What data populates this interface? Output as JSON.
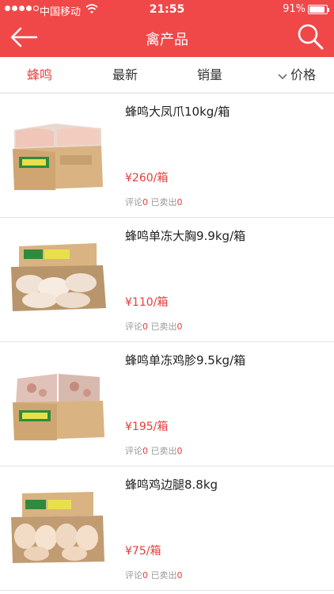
{
  "status_bar": {
    "carrier": "中国移动",
    "time": "21:55",
    "battery_text": "91%",
    "battery_level": 0.91
  },
  "header": {
    "title": "禽产品",
    "back_icon": "arrow-left-icon",
    "search_icon": "search-icon"
  },
  "tabs": [
    {
      "label": "蜂鸣",
      "active": true
    },
    {
      "label": "最新",
      "active": false
    },
    {
      "label": "销量",
      "active": false
    },
    {
      "label": "价格",
      "active": false
    }
  ],
  "meta_labels": {
    "comment": "评论",
    "sold": "已卖出"
  },
  "products": [
    {
      "title": "蜂鸣大凤爪10kg/箱",
      "price": "¥260/箱",
      "comments": "0",
      "sold": "0"
    },
    {
      "title": "蜂鸣单冻大胸9.9kg/箱",
      "price": "¥110/箱",
      "comments": "0",
      "sold": "0"
    },
    {
      "title": "蜂鸣单冻鸡胗9.5kg/箱",
      "price": "¥195/箱",
      "comments": "0",
      "sold": "0"
    },
    {
      "title": "蜂鸣鸡边腿8.8kg",
      "price": "¥75/箱",
      "comments": "0",
      "sold": "0"
    }
  ],
  "colors": {
    "accent": "#f04848",
    "price": "#e83c3c",
    "meta": "#9a9a9a"
  }
}
